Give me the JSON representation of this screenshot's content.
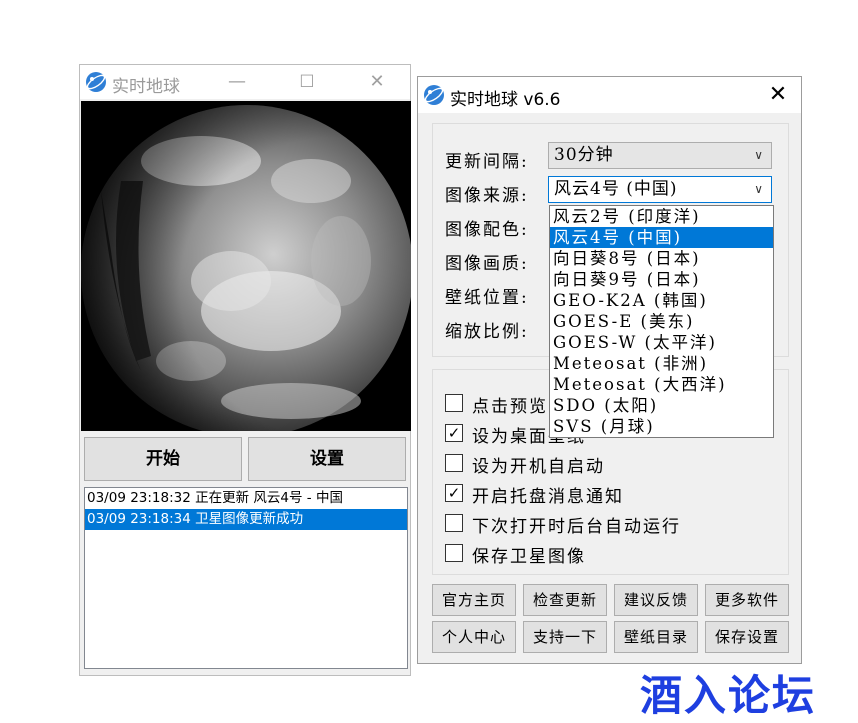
{
  "left_window": {
    "title": "实时地球",
    "controls": {
      "minimize": "—",
      "maximize": "☐",
      "close": "✕"
    },
    "buttons": {
      "start": "开始",
      "settings": "设置"
    },
    "log": [
      "03/09 23:18:32 正在更新 风云4号 - 中国",
      "03/09 23:18:34 卫星图像更新成功"
    ],
    "log_selected_index": 1
  },
  "right_window": {
    "title": "实时地球 v6.6",
    "close": "✕",
    "fields": [
      {
        "label": "更新间隔:",
        "value": "30分钟"
      },
      {
        "label": "图像来源:",
        "value": "风云4号 (中国)"
      },
      {
        "label": "图像配色:"
      },
      {
        "label": "图像画质:"
      },
      {
        "label": "壁纸位置:"
      },
      {
        "label": "缩放比例:"
      }
    ],
    "checkboxes": [
      {
        "label": "点击预览",
        "checked": false
      },
      {
        "label": "设为桌面壁纸",
        "checked": true
      },
      {
        "label": "设为开机自启动",
        "checked": false
      },
      {
        "label": "开启托盘消息通知",
        "checked": true
      },
      {
        "label": "下次打开时后台自动运行",
        "checked": false
      },
      {
        "label": "保存卫星图像",
        "checked": false
      }
    ],
    "buttons_row1": [
      "官方主页",
      "检查更新",
      "建议反馈",
      "更多软件"
    ],
    "buttons_row2": [
      "个人中心",
      "支持一下",
      "壁纸目录",
      "保存设置"
    ]
  },
  "dropdown": {
    "options": [
      "风云2号 (印度洋)",
      "风云4号 (中国)",
      "向日葵8号 (日本)",
      "向日葵9号 (日本)",
      "GEO-K2A (韩国)",
      "GOES-E (美东)",
      "GOES-W (太平洋)",
      "Meteosat (非洲)",
      "Meteosat (大西洋)",
      "SDO (太阳)",
      "SVS (月球)"
    ],
    "selected_index": 1
  },
  "watermark": "酒入论坛",
  "colors": {
    "accent": "#0078d7",
    "watermark": "#1e3fe0"
  }
}
